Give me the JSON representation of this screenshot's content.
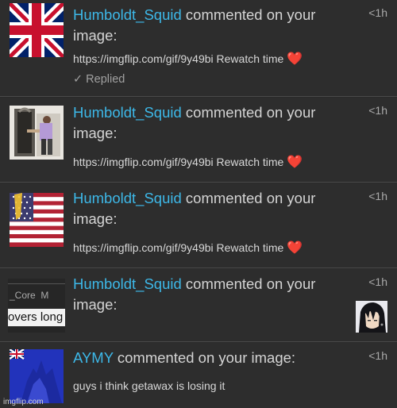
{
  "notifications": [
    {
      "username": "Humboldt_Squid",
      "action": "commented on your image:",
      "comment": "https://imgflip.com/gif/9y49bi Rewatch time",
      "emoji": "❤️",
      "time": "<1h",
      "replied": "✓ Replied",
      "thumb": "uk-flag-thumbnail"
    },
    {
      "username": "Humboldt_Squid",
      "action": "commented on your image:",
      "comment": "https://imgflip.com/gif/9y49bi Rewatch time",
      "emoji": "❤️",
      "time": "<1h",
      "thumb": "photo-thumbnail"
    },
    {
      "username": "Humboldt_Squid",
      "action": "commented on your image:",
      "comment": "https://imgflip.com/gif/9y49bi Rewatch time",
      "emoji": "❤️",
      "time": "<1h",
      "thumb": "us-flag-thumbnail"
    },
    {
      "username": "Humboldt_Squid",
      "action": "commented on your image:",
      "time": "<1h",
      "thumb_text_1": "_Core  M",
      "thumb_text_2": "overs long",
      "side_image": "anime-character-image"
    },
    {
      "username": "AYMY",
      "action": "commented on your image:",
      "comment": "guys i think getawax is losing it",
      "time": "<1h",
      "thumb": "blue-flag-thumbnail"
    }
  ],
  "watermark": "imgflip.com"
}
